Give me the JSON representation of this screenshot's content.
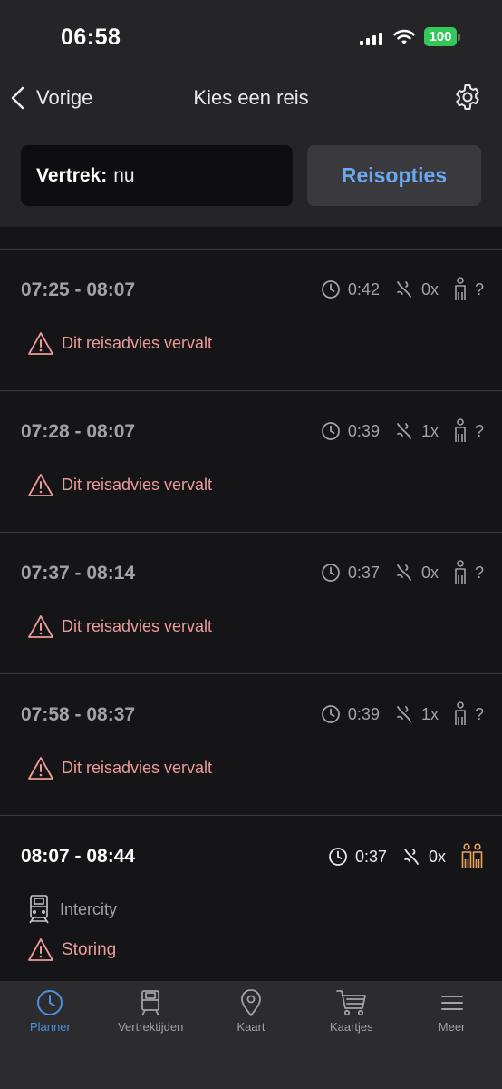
{
  "status_bar": {
    "time": "06:58",
    "battery": "100"
  },
  "header": {
    "back_label": "Vorige",
    "title": "Kies een reis"
  },
  "search": {
    "departure_label": "Vertrek:",
    "departure_value": "nu",
    "options_label": "Reisopties"
  },
  "trips": [
    {
      "time": "07:25 - 08:07",
      "duration": "0:42",
      "transfers": "0x",
      "crowding": "?",
      "warning": "Dit reisadvies vervalt"
    },
    {
      "time": "07:28 - 08:07",
      "duration": "0:39",
      "transfers": "1x",
      "crowding": "?",
      "warning": "Dit reisadvies vervalt"
    },
    {
      "time": "07:37 - 08:14",
      "duration": "0:37",
      "transfers": "0x",
      "crowding": "?",
      "warning": "Dit reisadvies vervalt"
    },
    {
      "time": "07:58 - 08:37",
      "duration": "0:39",
      "transfers": "1x",
      "crowding": "?",
      "warning": "Dit reisadvies vervalt"
    },
    {
      "time": "08:07 - 08:44",
      "duration": "0:37",
      "transfers": "0x",
      "train_type": "Intercity",
      "disruption": "Storing"
    }
  ],
  "tabs": [
    {
      "label": "Planner",
      "icon": "clock-icon",
      "active": true
    },
    {
      "label": "Vertrektijden",
      "icon": "train-icon"
    },
    {
      "label": "Kaart",
      "icon": "map-pin-icon"
    },
    {
      "label": "Kaartjes",
      "icon": "cart-icon"
    },
    {
      "label": "Meer",
      "icon": "menu-icon"
    }
  ],
  "colors": {
    "accent": "#4f8fe0",
    "options_text": "#6aa9f0",
    "warning": "#ec9a9a",
    "crowding_orange": "#f0a65a",
    "battery": "#34c759"
  }
}
